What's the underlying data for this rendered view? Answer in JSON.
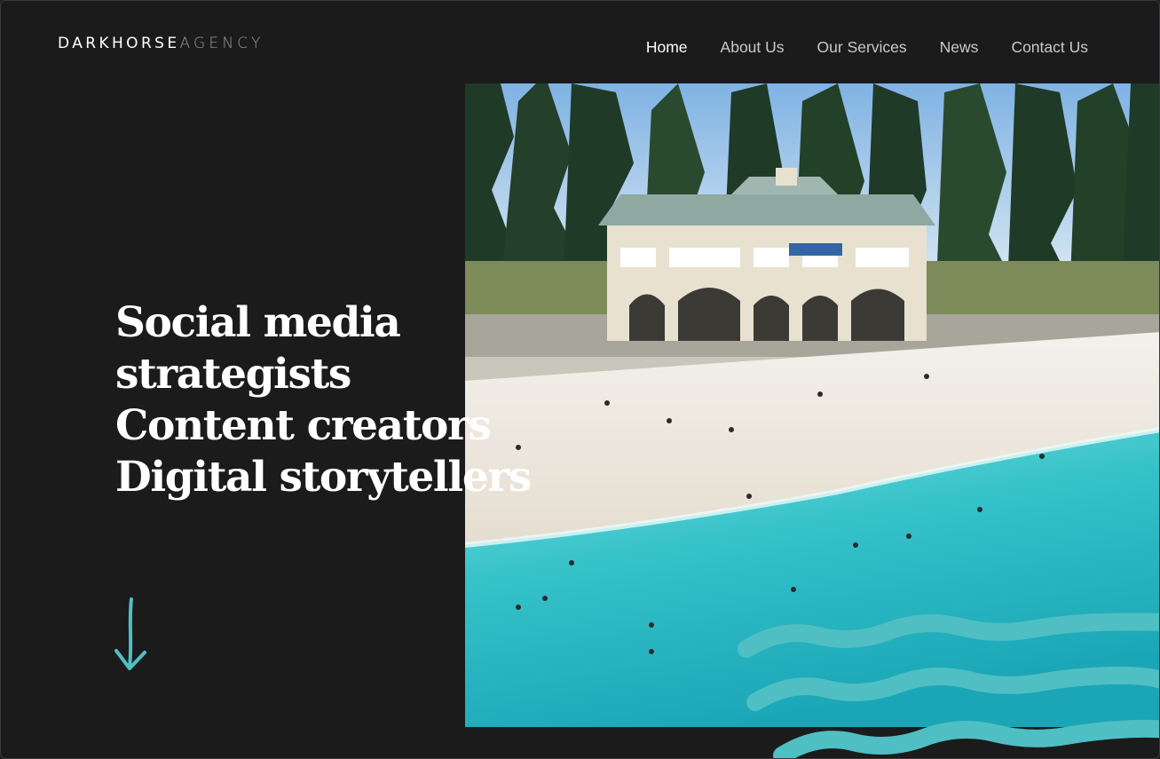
{
  "brand": {
    "logo_bold": "DARKHORSE",
    "logo_light": "AGENCY"
  },
  "nav": {
    "items": [
      {
        "label": "Home",
        "active": true
      },
      {
        "label": "About Us",
        "active": false
      },
      {
        "label": "Our Services",
        "active": false
      },
      {
        "label": "News",
        "active": false
      },
      {
        "label": "Contact Us",
        "active": false
      }
    ]
  },
  "hero": {
    "lines": [
      "Social media",
      "strategists",
      "Content creators",
      "Digital storytellers"
    ],
    "image_icon": "beach-pavilion-photo",
    "arrow_icon": "down-arrow-icon"
  },
  "colors": {
    "background": "#1b1b1c",
    "accent": "#4fbfc4",
    "nav_text": "#c9c9cb",
    "nav_active": "#ffffff"
  }
}
